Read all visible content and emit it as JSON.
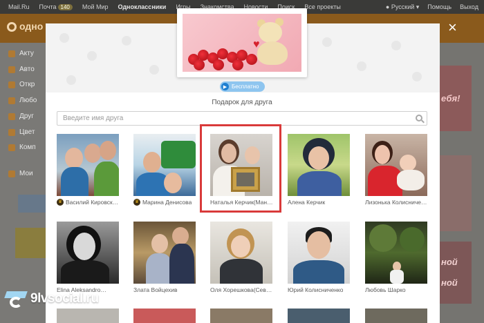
{
  "topbar": {
    "items": [
      "Mail.Ru",
      "Почта",
      "Мой Мир",
      "Одноклассники",
      "Игры",
      "Знакомства",
      "Новости",
      "Поиск",
      "Все проекты"
    ],
    "mail_badge": "140",
    "language": "Русский",
    "help": "Помощь",
    "logout": "Выход"
  },
  "header": {
    "logo": "одно"
  },
  "sidebar": {
    "items": [
      {
        "label": "Акту"
      },
      {
        "label": "Авто"
      },
      {
        "label": "Откр"
      },
      {
        "label": "Любо"
      },
      {
        "label": "Друг"
      },
      {
        "label": "Цвет"
      },
      {
        "label": "Комп"
      },
      {
        "label": "Мои"
      }
    ]
  },
  "promo": {
    "right_text": "ебя!",
    "right_text2": "ной",
    "right_text3": "ной"
  },
  "modal": {
    "close_symbol": "×",
    "free_label": "Бесплатно",
    "title": "Подарок для друга",
    "search_placeholder": "Введите имя друга"
  },
  "friends": [
    {
      "name": "Василий Кировск…",
      "vip": true
    },
    {
      "name": "Марина Денисова",
      "vip": true
    },
    {
      "name": "Наталья Керчик(Ман…",
      "vip": false
    },
    {
      "name": "Алена Керчик",
      "vip": false
    },
    {
      "name": "Лизонька Колисниче…",
      "vip": false
    },
    {
      "name": "Elina Aleksandro…",
      "vip": false
    },
    {
      "name": "Злата Войцехив",
      "vip": false
    },
    {
      "name": "Оля Хорешкова(Сев…",
      "vip": false
    },
    {
      "name": "Юрий Колисниченко",
      "vip": false
    },
    {
      "name": "Любовь Шарко",
      "vip": false
    }
  ],
  "crown_symbol": "♛",
  "watermark": {
    "text": "9lvsocial.ru"
  },
  "colors": {
    "highlight": "#d93a3a",
    "free_badge": "#8ec5ef",
    "topbar": "#3a3a38",
    "header": "#8a5a1c"
  }
}
